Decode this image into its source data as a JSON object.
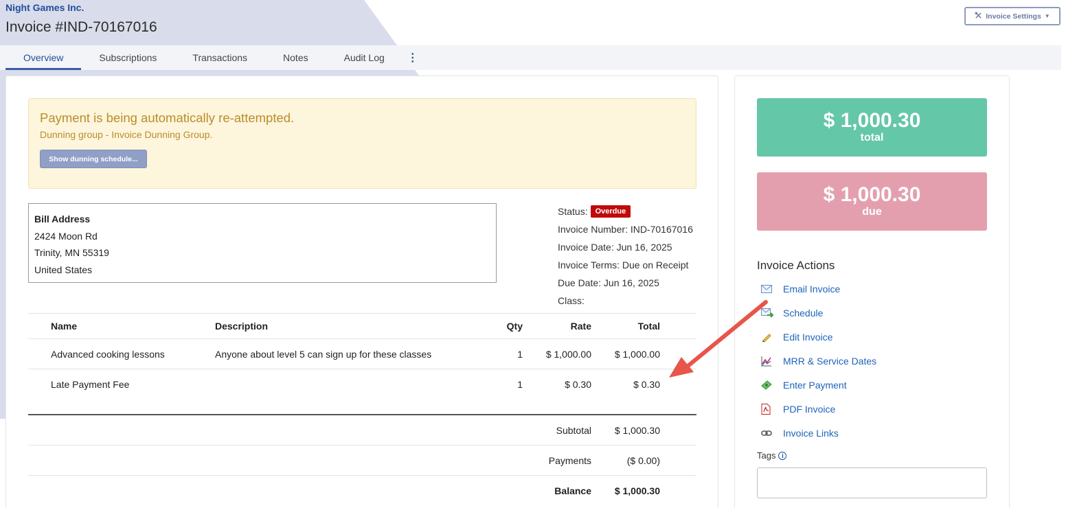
{
  "header": {
    "company": "Night Games Inc.",
    "title": "Invoice #IND-70167016",
    "settings_label": "Invoice Settings"
  },
  "tabs": [
    {
      "label": "Overview",
      "active": true
    },
    {
      "label": "Subscriptions"
    },
    {
      "label": "Transactions"
    },
    {
      "label": "Notes"
    },
    {
      "label": "Audit Log"
    }
  ],
  "alert": {
    "title": "Payment is being automatically re-attempted.",
    "subtitle": "Dunning group - Invoice Dunning Group.",
    "button_label": "Show dunning schedule..."
  },
  "address": {
    "title": "Bill Address",
    "line1": "2424 Moon Rd",
    "line2": "Trinity, MN 55319",
    "line3": "United States"
  },
  "info": {
    "status_label": "Status:",
    "status_badge": "Overdue",
    "invoice_number": "Invoice Number: IND-70167016",
    "invoice_date": "Invoice Date: Jun 16, 2025",
    "invoice_terms": "Invoice Terms: Due on Receipt",
    "due_date": "Due Date: Jun 16, 2025",
    "class": "Class:"
  },
  "table": {
    "headers": {
      "name": "Name",
      "description": "Description",
      "qty": "Qty",
      "rate": "Rate",
      "total": "Total"
    },
    "rows": [
      {
        "name": "Advanced cooking lessons",
        "description": "Anyone about level 5 can sign up for these classes",
        "qty": "1",
        "rate": "$ 1,000.00",
        "total": "$ 1,000.00"
      },
      {
        "name": "Late Payment Fee",
        "description": "",
        "qty": "1",
        "rate": "$ 0.30",
        "total": "$ 0.30"
      }
    ]
  },
  "totals": {
    "subtotal_label": "Subtotal",
    "subtotal": "$ 1,000.30",
    "payments_label": "Payments",
    "payments": "($ 0.00)",
    "balance_label": "Balance",
    "balance": "$ 1,000.30"
  },
  "summary": {
    "total_amount": "$ 1,000.30",
    "total_label": "total",
    "due_amount": "$ 1,000.30",
    "due_label": "due",
    "total_color": "#64c7a7",
    "due_color": "#e49faf"
  },
  "actions": {
    "title": "Invoice Actions",
    "items": [
      {
        "label": "Email Invoice",
        "icon": "envelope-icon"
      },
      {
        "label": "Schedule",
        "icon": "schedule-icon"
      },
      {
        "label": "Edit Invoice",
        "icon": "pencil-icon"
      },
      {
        "label": "MRR & Service Dates",
        "icon": "chart-icon"
      },
      {
        "label": "Enter Payment",
        "icon": "money-icon"
      },
      {
        "label": "PDF Invoice",
        "icon": "pdf-icon"
      },
      {
        "label": "Invoice Links",
        "icon": "link-icon"
      }
    ]
  },
  "tags": {
    "label": "Tags"
  },
  "colors": {
    "brand": "#1f4e9c",
    "link": "#1e63b8",
    "overdue": "#c00a0a",
    "annotation_arrow": "#e8554a"
  }
}
